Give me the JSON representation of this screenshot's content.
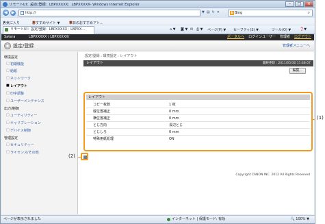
{
  "window": {
    "title": "リモートUI：設定/登録：LBPXXXXX：LBPXXXXX- Windows Internet Explorer"
  },
  "address_bar": {
    "url": "http://",
    "search_text": "Bing"
  },
  "favorites_bar": {
    "favorites_label": "お気に入り",
    "suggested_sites": "おすすめサイト ▼",
    "web_slice": "本日のおすすめアト..."
  },
  "tab": {
    "label": "リモートUI：設定/登録：LBPXXXXX：LBPXX..."
  },
  "command_bar": {
    "page_menu": "ページ(P) ▼",
    "safety_menu": "セーフティ(S) ▼",
    "tools_menu": "ツール(O) ▼"
  },
  "site_header": {
    "brand": "Satera",
    "device": "LBPXXXXX / LBPXXXXX/",
    "portal_link": "ポータルへ",
    "login_user": "ログインユーザー",
    "admin": "管理者",
    "logout_link": "ログアウト",
    "page_title": "設定/登録",
    "to_management": "管理者メニューへ"
  },
  "sidebar": {
    "sections": [
      {
        "heading": "環境設定",
        "items": [
          "初期機能",
          "給紙",
          "ネットワーク",
          "レイアウト",
          "印字調整",
          "ユーザーメンテナンス"
        ],
        "active": "レイアウト"
      },
      {
        "heading": "出力/制御",
        "items": [
          "ユーティリティー",
          "キャリブレーション",
          "デバイス制御"
        ]
      },
      {
        "heading": "管理設定",
        "items": [
          "セキュリティー",
          "ライセンス/その他"
        ]
      }
    ]
  },
  "content": {
    "breadcrumb": "設定/登録 : 環境設定 : レイアウト",
    "panel_title": "レイアウト",
    "last_updated": "最終更新 : 2011/05/30 11:48:07",
    "edit_button": "編集...",
    "section_title": "レイアウト",
    "fields": [
      {
        "key": "コピー枚数",
        "value": "1 枚"
      },
      {
        "key": "縦位置補正",
        "value": "0 mm"
      },
      {
        "key": "横位置補正",
        "value": "0 mm"
      },
      {
        "key": "とじ方向",
        "value": "長辺とじ"
      },
      {
        "key": "とじしろ",
        "value": "0 mm"
      },
      {
        "key": "特殊用紙処理",
        "value": "ON"
      }
    ],
    "copyright": "Copyright CANON INC. 2012 All Rights Reserved"
  },
  "callouts": {
    "one": "(1)",
    "two": "(2)"
  },
  "status_bar": {
    "left": "ページが表示されました",
    "zone": "インターネット | 保護モード: 有効",
    "zoom": "100%"
  },
  "colors": {
    "highlight": "#f29a1b",
    "header_dark": "#2b2b2b",
    "link": "#3660a8"
  }
}
